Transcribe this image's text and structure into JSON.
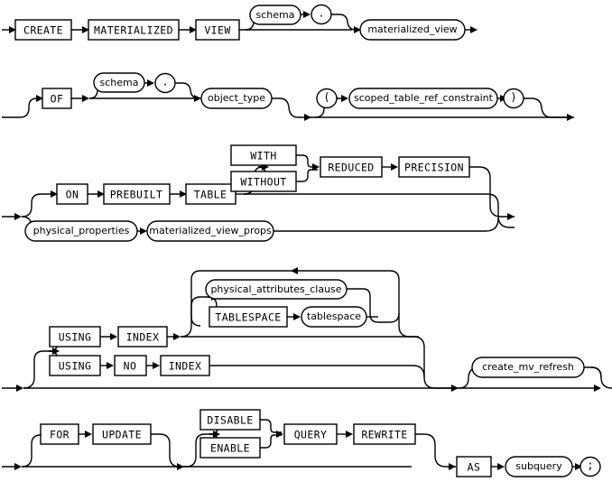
{
  "diagram": {
    "kind": "railroad-syntax-diagram",
    "statement": "CREATE MATERIALIZED VIEW",
    "line_color": "#000000",
    "background_color": "#ffffff"
  },
  "rows": [
    {
      "id": "row-create",
      "tokens": [
        {
          "name": "create-keyword",
          "label": "CREATE",
          "shape": "box"
        },
        {
          "name": "materialized-keyword",
          "label": "MATERIALIZED",
          "shape": "box"
        },
        {
          "name": "view-keyword",
          "label": "VIEW",
          "shape": "box"
        },
        {
          "name": "schema-nonterminal",
          "label": "schema",
          "shape": "stadium"
        },
        {
          "name": "dot-punctuation",
          "label": ".",
          "shape": "circle"
        },
        {
          "name": "materialized-view-nonterminal",
          "label": "materialized_view",
          "shape": "stadium"
        }
      ]
    },
    {
      "id": "row-of",
      "tokens": [
        {
          "name": "of-keyword",
          "label": "OF",
          "shape": "box"
        },
        {
          "name": "schema-nonterminal",
          "label": "schema",
          "shape": "stadium"
        },
        {
          "name": "dot-punctuation",
          "label": ".",
          "shape": "circle"
        },
        {
          "name": "object-type-nonterminal",
          "label": "object_type",
          "shape": "stadium"
        },
        {
          "name": "open-paren-punctuation",
          "label": "(",
          "shape": "circle"
        },
        {
          "name": "scoped-table-ref-constraint-nonterminal",
          "label": "scoped_table_ref_constraint",
          "shape": "stadium"
        },
        {
          "name": "close-paren-punctuation",
          "label": ")",
          "shape": "circle"
        }
      ]
    },
    {
      "id": "row-on-prebuilt-table",
      "tokens": [
        {
          "name": "on-keyword",
          "label": "ON",
          "shape": "box"
        },
        {
          "name": "prebuilt-keyword",
          "label": "PREBUILT",
          "shape": "box"
        },
        {
          "name": "table-keyword",
          "label": "TABLE",
          "shape": "box"
        },
        {
          "name": "with-keyword",
          "label": "WITH",
          "shape": "box"
        },
        {
          "name": "without-keyword",
          "label": "WITHOUT",
          "shape": "box"
        },
        {
          "name": "reduced-keyword",
          "label": "REDUCED",
          "shape": "box"
        },
        {
          "name": "precision-keyword",
          "label": "PRECISION",
          "shape": "box"
        },
        {
          "name": "physical-properties-nonterminal",
          "label": "physical_properties",
          "shape": "stadium"
        },
        {
          "name": "materialized-view-props-nonterminal",
          "label": "materialized_view_props",
          "shape": "stadium"
        }
      ]
    },
    {
      "id": "row-using-index",
      "tokens": [
        {
          "name": "physical-attributes-clause-nonterminal",
          "label": "physical_attributes_clause",
          "shape": "stadium"
        },
        {
          "name": "tablespace-keyword",
          "label": "TABLESPACE",
          "shape": "box"
        },
        {
          "name": "tablespace-nonterminal",
          "label": "tablespace",
          "shape": "stadium"
        },
        {
          "name": "using-keyword",
          "label": "USING",
          "shape": "box"
        },
        {
          "name": "index-keyword",
          "label": "INDEX",
          "shape": "box"
        },
        {
          "name": "using-keyword-2",
          "label": "USING",
          "shape": "box"
        },
        {
          "name": "no-keyword",
          "label": "NO",
          "shape": "box"
        },
        {
          "name": "index-keyword-2",
          "label": "INDEX",
          "shape": "box"
        },
        {
          "name": "create-mv-refresh-nonterminal",
          "label": "create_mv_refresh",
          "shape": "stadium"
        }
      ]
    },
    {
      "id": "row-for-update",
      "tokens": [
        {
          "name": "for-keyword",
          "label": "FOR",
          "shape": "box"
        },
        {
          "name": "update-keyword",
          "label": "UPDATE",
          "shape": "box"
        },
        {
          "name": "disable-keyword",
          "label": "DISABLE",
          "shape": "box"
        },
        {
          "name": "enable-keyword",
          "label": "ENABLE",
          "shape": "box"
        },
        {
          "name": "query-keyword",
          "label": "QUERY",
          "shape": "box"
        },
        {
          "name": "rewrite-keyword",
          "label": "REWRITE",
          "shape": "box"
        },
        {
          "name": "as-keyword",
          "label": "AS",
          "shape": "box"
        },
        {
          "name": "subquery-nonterminal",
          "label": "subquery",
          "shape": "stadium"
        },
        {
          "name": "semicolon-punctuation",
          "label": ";",
          "shape": "circle"
        }
      ]
    }
  ],
  "labels": {
    "create": "CREATE",
    "materialized": "MATERIALIZED",
    "view": "VIEW",
    "schema": "schema",
    "dot": ".",
    "materialized_view": "materialized_view",
    "of": "OF",
    "object_type": "object_type",
    "open_paren": "(",
    "scoped_table_ref_constraint": "scoped_table_ref_constraint",
    "close_paren": ")",
    "on": "ON",
    "prebuilt": "PREBUILT",
    "table": "TABLE",
    "with": "WITH",
    "without": "WITHOUT",
    "reduced": "REDUCED",
    "precision": "PRECISION",
    "physical_properties": "physical_properties",
    "materialized_view_props": "materialized_view_props",
    "physical_attributes_clause": "physical_attributes_clause",
    "tablespace_kw": "TABLESPACE",
    "tablespace": "tablespace",
    "using": "USING",
    "index": "INDEX",
    "no": "NO",
    "create_mv_refresh": "create_mv_refresh",
    "for": "FOR",
    "update": "UPDATE",
    "disable": "DISABLE",
    "enable": "ENABLE",
    "query": "QUERY",
    "rewrite": "REWRITE",
    "as": "AS",
    "subquery": "subquery",
    "semicolon": ";"
  }
}
